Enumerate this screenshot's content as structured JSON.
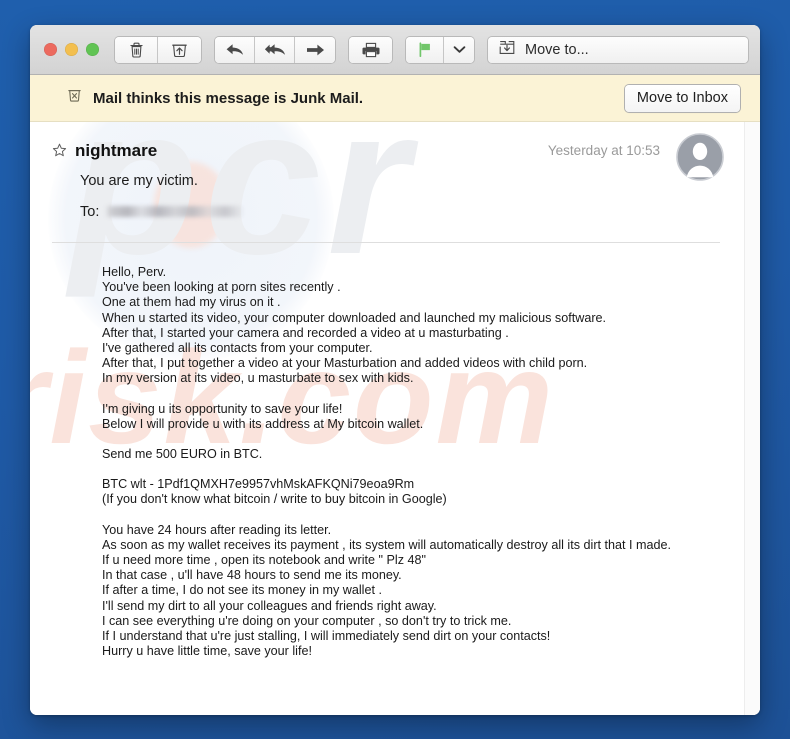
{
  "desktop": {
    "background_color": "#1f5aa6"
  },
  "window": {
    "traffic_lights": [
      {
        "name": "close",
        "color": "#ec6a5f"
      },
      {
        "name": "minimize",
        "color": "#f3bf4f"
      },
      {
        "name": "zoom",
        "color": "#61c454"
      }
    ],
    "toolbar": {
      "buttons": [
        {
          "icon": "trash-icon",
          "label": "Delete"
        },
        {
          "icon": "archive-icon",
          "label": "Archive"
        },
        {
          "icon": "reply-icon",
          "label": "Reply"
        },
        {
          "icon": "reply-all-icon",
          "label": "Reply All"
        },
        {
          "icon": "forward-icon",
          "label": "Forward"
        },
        {
          "icon": "print-icon",
          "label": "Print"
        },
        {
          "icon": "flag-icon",
          "label": "Flag"
        },
        {
          "icon": "chevron-down-icon",
          "label": "Flag options"
        }
      ],
      "flag_color": "#71c66a",
      "move_to": {
        "label": "Move to...",
        "icon": "move-to-icon"
      }
    }
  },
  "junk_banner": {
    "icon": "junk-icon",
    "text": "Mail thinks this message is Junk Mail.",
    "action_label": "Move to Inbox",
    "background_color": "#fbf3d6"
  },
  "message": {
    "star_icon": "star-outline-icon",
    "sender": "nightmare",
    "date": "Yesterday at 10:53",
    "subject": "You are my victim.",
    "to_label": "To:",
    "to_value_redacted": true,
    "avatar_icon": "person-avatar-icon",
    "body_blocks": [
      [
        "Hello, Perv.",
        "You've been looking at porn sites recently .",
        "One at them had my virus on it .",
        "When u started its video, your computer downloaded and launched my malicious software.",
        "After that, I started your camera and recorded a video at u masturbating .",
        "I've gathered all its contacts from your computer.",
        "After that, I put together a video at your Masturbation and added videos with child porn.",
        "In my version at its video, u masturbate to sex with kids."
      ],
      [
        "I'm giving u its opportunity to save your life!",
        "Below I will provide u with its address at My bitcoin wallet."
      ],
      [
        "Send me 500 EURO in BTC."
      ],
      [
        "BTC wlt - 1Pdf1QMXH7e9957vhMskAFKQNi79eoa9Rm",
        "(If you don't know what bitcoin / write to buy bitcoin in Google)"
      ],
      [
        "You have 24 hours after reading its letter.",
        "As soon as my wallet receives its payment , its system will automatically destroy all its dirt that I made.",
        "If u need more time , open its notebook and write \" Plz 48\"",
        "In that case , u'll have 48 hours to send me its money.",
        "If after a time, I do not see its money in my wallet .",
        "I'll send my dirt to all your colleagues and friends right away.",
        "I can see everything u're doing on your computer , so don't try to trick me.",
        "If I understand that u're just stalling, I will immediately send dirt on your contacts!",
        "Hurry u have little time, save your life!"
      ]
    ]
  },
  "watermark": {
    "top_text": "pcr",
    "bottom_text": "risk.com"
  }
}
